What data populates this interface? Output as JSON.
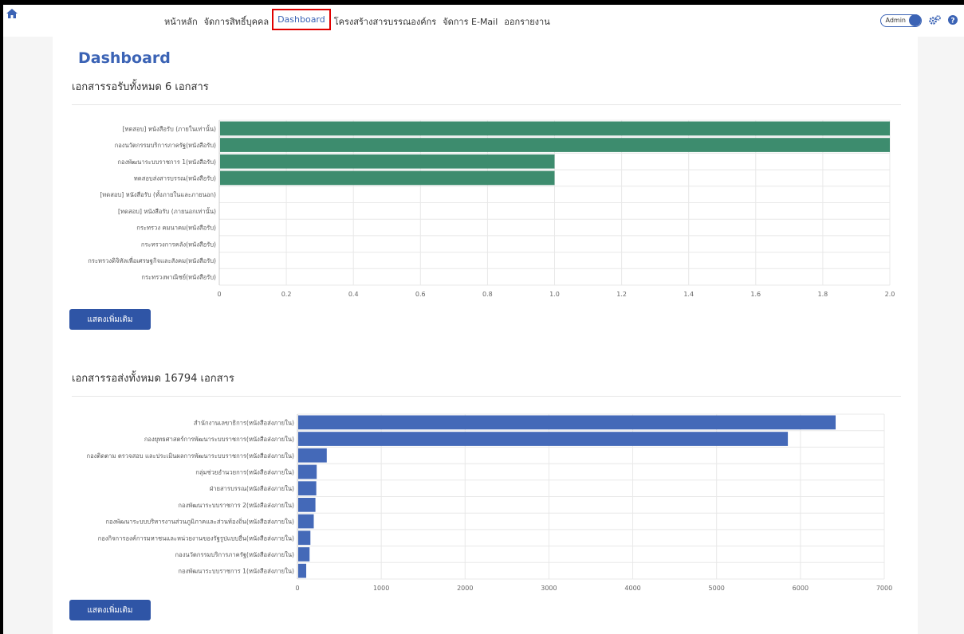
{
  "nav": {
    "items": [
      "หน้าหลัก",
      "จัดการสิทธิ์บุคคล",
      "Dashboard",
      "โครงสร้างสารบรรณองค์กร",
      "จัดการ E-Mail",
      "ออกรายงาน"
    ],
    "active": "Dashboard",
    "role": "Admin"
  },
  "page": {
    "title": "Dashboard",
    "received_title": "เอกสารรอรับทั้งหมด 6 เอกสาร",
    "sent_title": "เอกสารรอส่งทั้งหมด 16794 เอกสาร",
    "more_button": "แสดงเพิ่มเติม"
  },
  "colors": {
    "accent": "#3b63b5",
    "received_bar": "#3d8c6e",
    "sent_bar": "#4469b8",
    "active_border": "#e00000"
  },
  "chart_data": [
    {
      "type": "bar",
      "orientation": "horizontal",
      "categories": [
        "[ทดสอบ] หนังสือรับ (ภายในเท่านั้น)",
        "กองนวัตกรรมบริการภาครัฐ(หนังสือรับ)",
        "กองพัฒนาระบบราชการ 1(หนังสือรับ)",
        "ทดสอบส่งสารบรรณ(หนังสือรับ)",
        "[ทดสอบ] หนังสือรับ (ทั้งภายในและภายนอก)",
        "[ทดสอบ] หนังสือรับ (ภายนอกเท่านั้น)",
        "กระทรวง คมนาคม(หนังสือรับ)",
        "กระทรวงการคลัง(หนังสือรับ)",
        "กระทรวงดิจิทัลเพื่อเศรษฐกิจและสังคม(หนังสือรับ)",
        "กระทรวงพาณิชย์(หนังสือรับ)"
      ],
      "values": [
        2,
        2,
        1,
        1,
        0,
        0,
        0,
        0,
        0,
        0
      ],
      "ticks": [
        "0",
        "0.2",
        "0.4",
        "0.6",
        "0.8",
        "1.0",
        "1.2",
        "1.4",
        "1.6",
        "1.8",
        "2.0"
      ],
      "xlim": [
        0,
        2
      ],
      "color": "#3d8c6e"
    },
    {
      "type": "bar",
      "orientation": "horizontal",
      "categories": [
        "สำนักงานเลขาธิการ(หนังสือส่งภายใน)",
        "กองยุทธศาสตร์การพัฒนาระบบราชการ(หนังสือส่งภายใน)",
        "กองติดตาม ตรวจสอบ และประเมินผลการพัฒนาระบบราชการ(หนังสือส่งภายใน)",
        "กลุ่มช่วยอำนวยการ(หนังสือส่งภายใน)",
        "ฝ่ายสารบรรณ(หนังสือส่งภายใน)",
        "กองพัฒนาระบบราชการ 2(หนังสือส่งภายใน)",
        "กองพัฒนาระบบบริหารงานส่วนภูมิภาคและส่วนท้องถิ่น(หนังสือส่งภายใน)",
        "กองกิจการองค์การมหาชนและหน่วยงานของรัฐรูปแบบอื่น(หนังสือส่งภายใน)",
        "กองนวัตกรรมบริการภาครัฐ(หนังสือส่งภายใน)",
        "กองพัฒนาระบบราชการ 1(หนังสือส่งภายใน)"
      ],
      "values": [
        6420,
        5850,
        350,
        230,
        225,
        215,
        195,
        155,
        145,
        105
      ],
      "ticks": [
        "0",
        "1000",
        "2000",
        "3000",
        "4000",
        "5000",
        "6000",
        "7000"
      ],
      "xlim": [
        0,
        7000
      ],
      "color": "#4469b8"
    }
  ]
}
